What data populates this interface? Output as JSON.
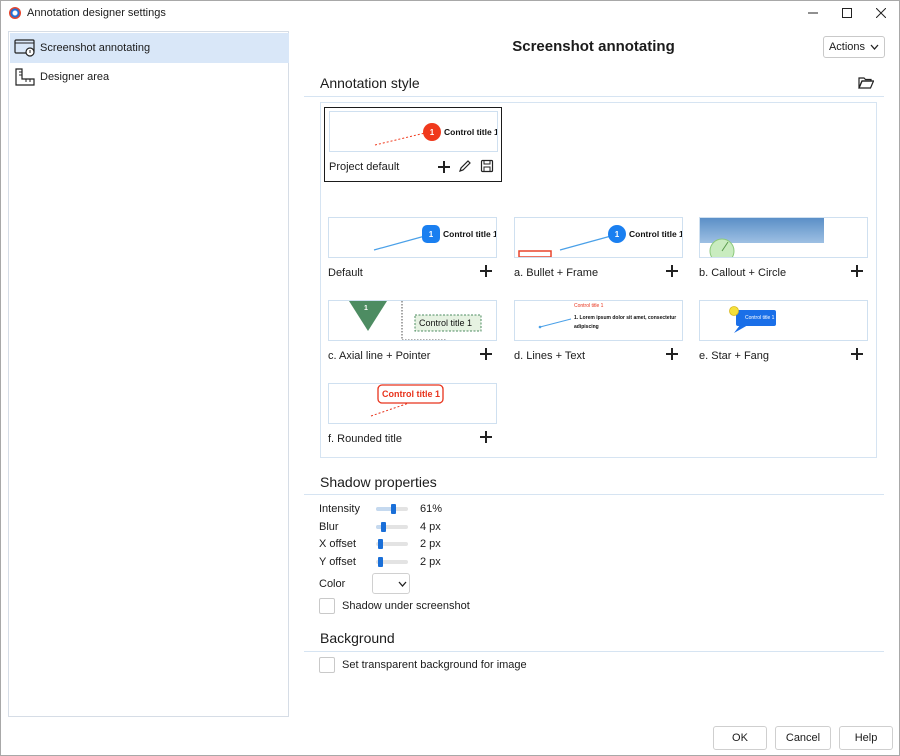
{
  "window": {
    "title": "Annotation designer settings"
  },
  "sidebar": {
    "items": [
      {
        "label": "Screenshot annotating",
        "icon": "screenshot-annotating-icon",
        "active": true
      },
      {
        "label": "Designer area",
        "icon": "ruler-icon",
        "active": false
      }
    ]
  },
  "header": {
    "title": "Screenshot annotating",
    "actions_label": "Actions"
  },
  "annotation_style": {
    "title": "Annotation style",
    "project_default": {
      "label": "Project default",
      "preview_text": "Control title 1",
      "badge": "1"
    },
    "styles": [
      {
        "label": "Default",
        "preview_text": "Control title 1",
        "badge": "1"
      },
      {
        "label": "a. Bullet + Frame",
        "preview_text": "Control title 1",
        "badge": "1"
      },
      {
        "label": "b. Callout + Circle"
      },
      {
        "label": "c. Axial line + Pointer",
        "preview_text": "Control title 1",
        "badge": "1"
      },
      {
        "label": "d. Lines + Text",
        "preview_caption": "Control title 1",
        "preview_text": "1. Lorem ipsum dolor sit amet, consectetur adipiscing"
      },
      {
        "label": "e. Star + Fang",
        "preview_text": "Control title 1"
      },
      {
        "label": "f. Rounded title",
        "preview_text": "Control title 1"
      }
    ]
  },
  "shadow": {
    "title": "Shadow properties",
    "intensity": {
      "label": "Intensity",
      "value": "61%",
      "level": 0.61
    },
    "blur": {
      "label": "Blur",
      "value": "4 px",
      "level": 0.2
    },
    "x_offset": {
      "label": "X offset",
      "value": "2 px",
      "level": 0.08
    },
    "y_offset": {
      "label": "Y offset",
      "value": "2 px",
      "level": 0.08
    },
    "color_label": "Color",
    "shadow_under_screenshot": {
      "label": "Shadow under screenshot",
      "checked": false
    }
  },
  "background": {
    "title": "Background",
    "transparent": {
      "label": "Set transparent background for image",
      "checked": false
    }
  },
  "footer": {
    "ok": "OK",
    "cancel": "Cancel",
    "help": "Help"
  },
  "colors": {
    "accent": "#1a6fd8",
    "sidebar_active": "#d9e7f8",
    "badge_orange": "#f0391c",
    "badge_blue": "#1a7ff0",
    "rounded_red": "#e8331c"
  }
}
